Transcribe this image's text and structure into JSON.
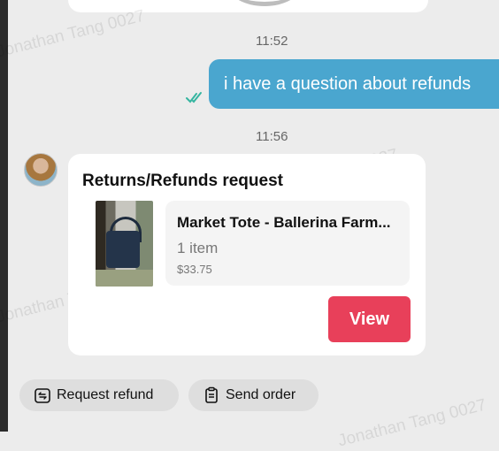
{
  "messages": {
    "time1": "11:52",
    "user_message": "i have a question about refunds",
    "time2": "11:56"
  },
  "card": {
    "title": "Returns/Refunds request",
    "product_name": "Market Tote - Ballerina Farm...",
    "quantity": "1 item",
    "price": "$33.75",
    "view_label": "View"
  },
  "actions": {
    "request_refund": "Request refund",
    "send_order": "Send order"
  },
  "watermark": "Jonathan Tang 0027",
  "colors": {
    "bubble": "#4aa6cf",
    "view_button": "#e8405a",
    "read_check": "#35b5a0"
  }
}
